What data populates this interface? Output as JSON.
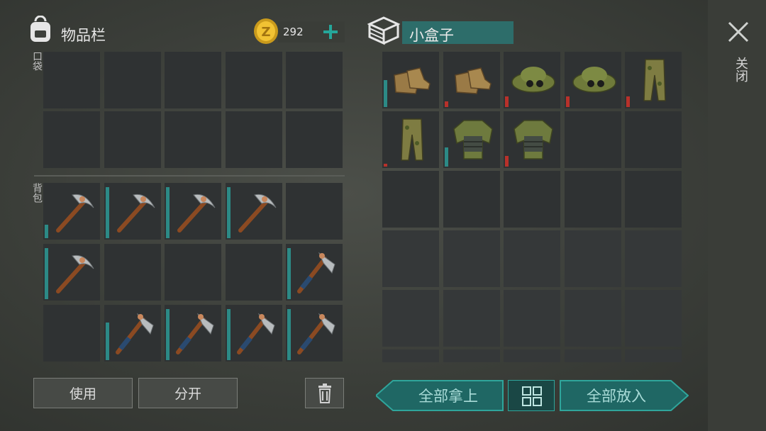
{
  "inventory": {
    "title": "物品栏",
    "coins": "292",
    "pocket_label": "口袋",
    "backpack_label": "背包",
    "pocket_slots": 10,
    "backpack_slots": [
      {
        "item": "pickaxe",
        "icon": "pickaxe-icon",
        "durability": 0.25
      },
      {
        "item": "pickaxe",
        "icon": "pickaxe-icon",
        "durability": 0.95
      },
      {
        "item": "pickaxe",
        "icon": "pickaxe-icon",
        "durability": 0.95
      },
      {
        "item": "pickaxe",
        "icon": "pickaxe-icon",
        "durability": 0.95
      },
      {
        "item": null
      },
      {
        "item": "pickaxe",
        "icon": "pickaxe-icon",
        "durability": 0.95
      },
      {
        "item": null
      },
      {
        "item": null
      },
      {
        "item": null
      },
      {
        "item": "hatchet",
        "icon": "hatchet-icon",
        "durability": 0.95
      },
      {
        "item": null
      },
      {
        "item": "hatchet",
        "icon": "hatchet-icon",
        "durability": 0.7
      },
      {
        "item": "hatchet",
        "icon": "hatchet-icon",
        "durability": 0.95
      },
      {
        "item": "hatchet",
        "icon": "hatchet-icon",
        "durability": 0.95
      },
      {
        "item": "hatchet",
        "icon": "hatchet-icon",
        "durability": 0.95
      }
    ],
    "use_label": "使用",
    "split_label": "分开"
  },
  "box": {
    "title": "小盒子",
    "close_label": "关闭",
    "slots": [
      {
        "item": "boots",
        "icon": "boots-icon",
        "durability": 0.5,
        "bar": "teal"
      },
      {
        "item": "boots",
        "icon": "boots-icon",
        "durability": 0.1,
        "bar": "red"
      },
      {
        "item": "boonie-hat",
        "icon": "hat-icon",
        "durability": 0.2,
        "bar": "red"
      },
      {
        "item": "boonie-hat",
        "icon": "hat-icon",
        "durability": 0.2,
        "bar": "red"
      },
      {
        "item": "camo-pants",
        "icon": "pants-icon",
        "durability": 0.2,
        "bar": "red"
      },
      {
        "item": "camo-pants",
        "icon": "pants-icon",
        "durability": 0.05,
        "bar": "red"
      },
      {
        "item": "camo-vest",
        "icon": "vest-icon",
        "durability": 0.35,
        "bar": "teal"
      },
      {
        "item": "camo-vest",
        "icon": "vest-icon",
        "durability": 0.2,
        "bar": "red"
      },
      {
        "item": null
      },
      {
        "item": null
      }
    ],
    "take_all_label": "全部拿上",
    "put_all_label": "全部放入",
    "sort_icon": "grid-icon"
  },
  "colors": {
    "teal": "#2c8a86",
    "red": "#b8312a",
    "accent": "#25a79a"
  }
}
